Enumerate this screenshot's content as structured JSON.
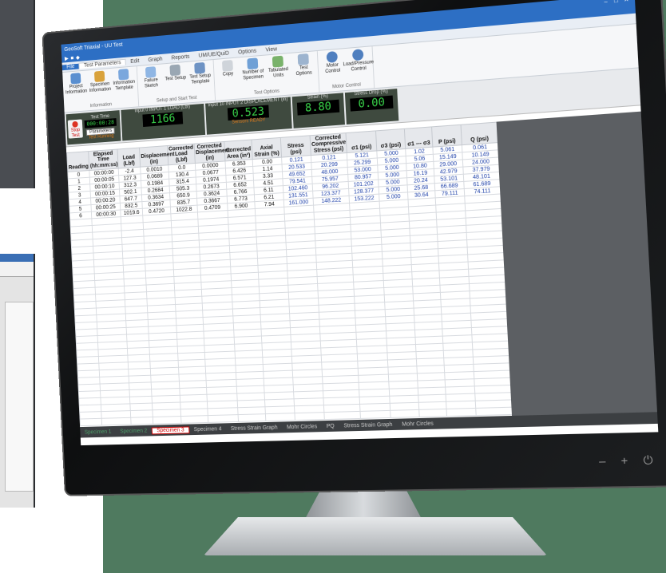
{
  "app": {
    "title": "GeoSoft Triaxial - UU Test",
    "file_menu": "File",
    "menu": [
      "Test Parameters",
      "Edit",
      "Graph",
      "Reports",
      "UM/UE/QuiD",
      "Options",
      "View"
    ],
    "window_buttons": [
      "–",
      "□",
      "✕"
    ]
  },
  "ribbon": {
    "groups": [
      {
        "label": "Information",
        "buttons": [
          "Project Information",
          "Specimen Information",
          "Information Template"
        ]
      },
      {
        "label": "Setup and Start Test",
        "buttons": [
          "Failure Sketch",
          "Test Setup",
          "Test Setup Template"
        ]
      },
      {
        "label": "Test Options",
        "buttons": [
          "Copy",
          "Number of Specimen",
          "Tabulated Units",
          "Test Options"
        ]
      },
      {
        "label": "Motor Control",
        "buttons": [
          "Motor Control",
          "Load/Pressure Control"
        ]
      }
    ]
  },
  "readouts": {
    "stop_label": "Stop Test",
    "test_time_label": "Test Time",
    "test_time": "000:00:28",
    "parameters_label": "Parameters",
    "test_running": "Test Running",
    "load_label": "Input 0 INPUT 1 LOAD (Lbf)",
    "load_value": "1166",
    "disp_label": "Input 10 INPUT 2 DISPLACEMENT (in)",
    "disp_value": "0.523",
    "sensor_note": "Sensors READY",
    "strain_label": "Strain (%)",
    "strain_value": "8.80",
    "stress_drop_label": "Stress Drop (%)",
    "stress_drop_value": "0.00"
  },
  "table": {
    "headers": [
      "Reading",
      "Elapsed Time (hh:mm:ss)",
      "Load (Lbf)",
      "Displacement (in)",
      "Corrected Load (Lbf)",
      "Corrected Displacement (in)",
      "Corrected Area (in²)",
      "Axial Strain (%)",
      "Stress (psi)",
      "Corrected Compressive Stress (psi)",
      "σ1 (psi)",
      "σ3 (psi)",
      "σ1 --- σ3",
      "P (psi)",
      "Q (psi)"
    ],
    "rows": [
      [
        "0",
        "00:00:00",
        "-2.4",
        "0.0010",
        "0.0",
        "0.0000",
        "6.353",
        "0.00",
        "0.121",
        "0.121",
        "5.121",
        "5.000",
        "1.02",
        "5.061",
        "0.061"
      ],
      [
        "1",
        "00:00:05",
        "127.3",
        "0.0689",
        "130.4",
        "0.0677",
        "6.426",
        "1.14",
        "20.533",
        "20.299",
        "25.299",
        "5.000",
        "5.06",
        "15.149",
        "10.149"
      ],
      [
        "2",
        "00:00:10",
        "312.3",
        "0.1984",
        "315.4",
        "0.1974",
        "6.571",
        "3.33",
        "49.652",
        "48.000",
        "53.000",
        "5.000",
        "10.80",
        "29.000",
        "24.000"
      ],
      [
        "3",
        "00:00:15",
        "502.1",
        "0.2684",
        "505.3",
        "0.2673",
        "6.652",
        "4.51",
        "79.541",
        "75.957",
        "80.957",
        "5.000",
        "16.19",
        "42.979",
        "37.979"
      ],
      [
        "4",
        "00:00:20",
        "647.7",
        "0.3634",
        "650.9",
        "0.3624",
        "6.766",
        "6.11",
        "102.460",
        "96.202",
        "101.202",
        "5.000",
        "20.24",
        "53.101",
        "48.101"
      ],
      [
        "5",
        "00:00:25",
        "832.5",
        "0.3697",
        "835.7",
        "0.3667",
        "6.773",
        "6.21",
        "131.551",
        "123.377",
        "128.377",
        "5.000",
        "25.68",
        "66.689",
        "61.689"
      ],
      [
        "6",
        "00:00:30",
        "1019.6",
        "0.4720",
        "1022.8",
        "0.4709",
        "6.900",
        "7.94",
        "161.000",
        "148.222",
        "153.222",
        "5.000",
        "30.64",
        "79.111",
        "74.111"
      ]
    ]
  },
  "tabs": [
    "Specimen 1",
    "Specimen 2",
    "Specimen 3",
    "Specimen 4",
    "Stress Strain Graph",
    "Mohr Circles",
    "PQ",
    "Stress Strain Graph",
    "Mohr Circles"
  ],
  "bezel_controls": [
    "–",
    "+",
    "⏻"
  ]
}
